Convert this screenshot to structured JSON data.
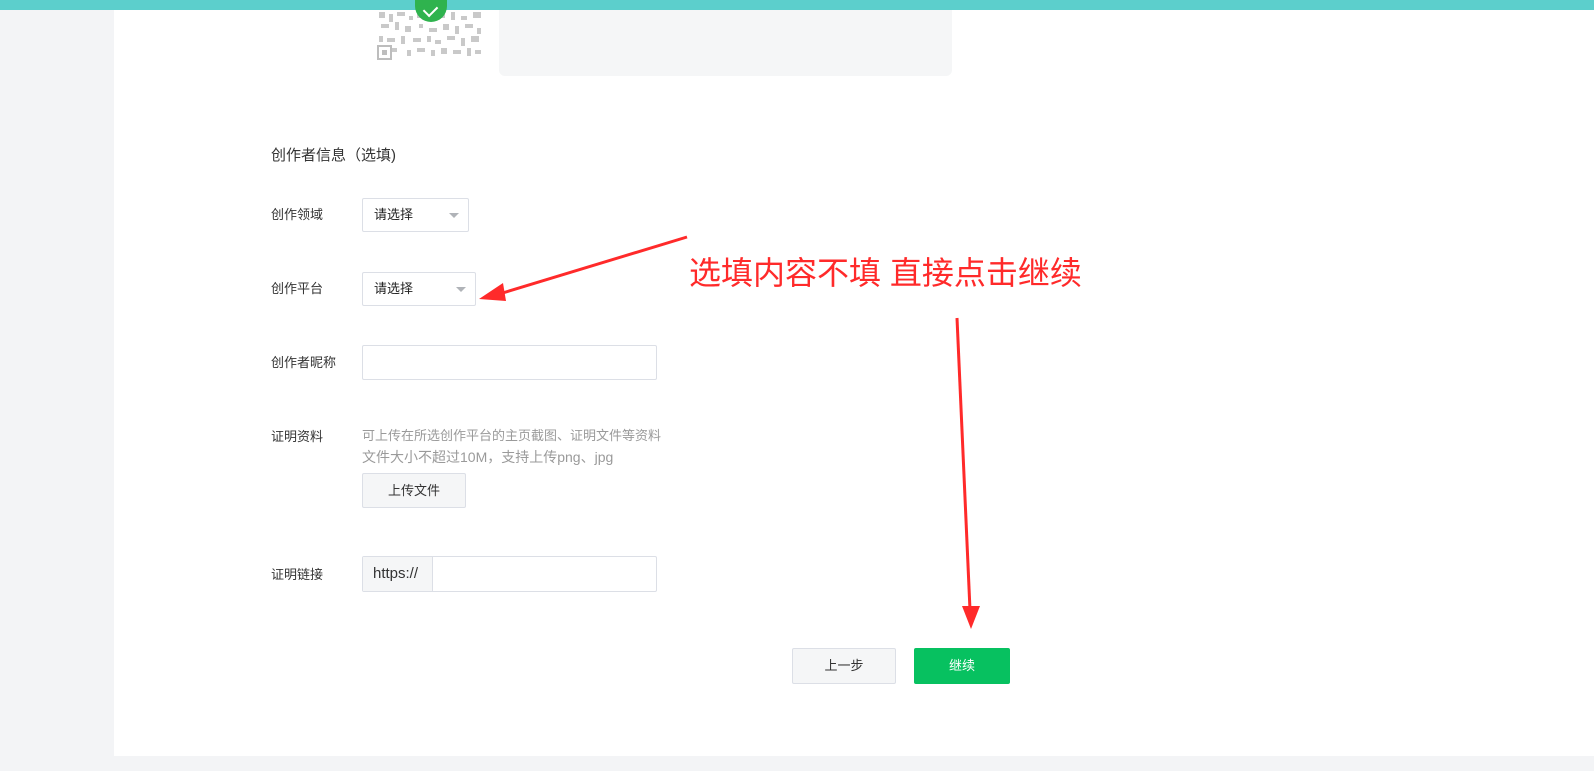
{
  "colors": {
    "accent": "#07c160",
    "top_bar": "#5ccfcc",
    "annotation": "#ff2a2a"
  },
  "qr": {
    "icon": "qr-code-icon",
    "badge_icon": "check-icon"
  },
  "form": {
    "section_title": "创作者信息（选填)",
    "field_domain": {
      "label": "创作领域",
      "value": "请选择"
    },
    "field_platform": {
      "label": "创作平台",
      "value": "请选择"
    },
    "field_nickname": {
      "label": "创作者昵称",
      "value": ""
    },
    "field_proof": {
      "label": "证明资料",
      "hint_line1": "可上传在所选创作平台的主页截图、证明文件等资料",
      "hint_line2": "文件大小不超过10M，支持上传png、jpg",
      "upload_label": "上传文件"
    },
    "field_link": {
      "label": "证明链接",
      "prefix": "https://",
      "value": ""
    }
  },
  "actions": {
    "prev_label": "上一步",
    "continue_label": "继续"
  },
  "annotation": {
    "text": "选填内容不填 直接点击继续"
  }
}
